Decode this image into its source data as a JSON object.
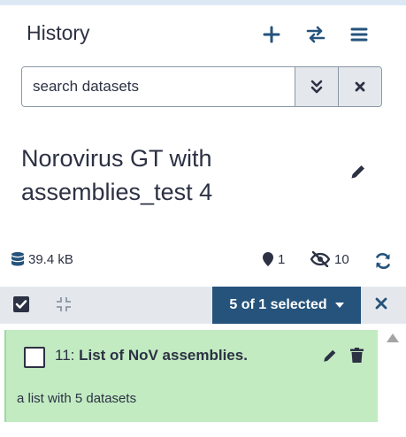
{
  "header": {
    "title": "History",
    "icons": [
      "plus-icon",
      "switch-icon",
      "menu-icon"
    ]
  },
  "search": {
    "placeholder": "search datasets",
    "value": ""
  },
  "history": {
    "name": "Norovirus GT with assemblies_test 4",
    "size": "39.4 kB",
    "visible_count": "1",
    "hidden_count": "10"
  },
  "selection": {
    "label": "5 of 1 selected"
  },
  "items": [
    {
      "hid": "11:",
      "name": "List of NoV assemblies.",
      "info": "a list with 5 datasets",
      "state_color": "#c2ebc2"
    }
  ],
  "colors": {
    "accent": "#25537b",
    "text": "#2c3143",
    "ok_state": "#c2ebc2",
    "toolbar": "#e4e8ed"
  }
}
